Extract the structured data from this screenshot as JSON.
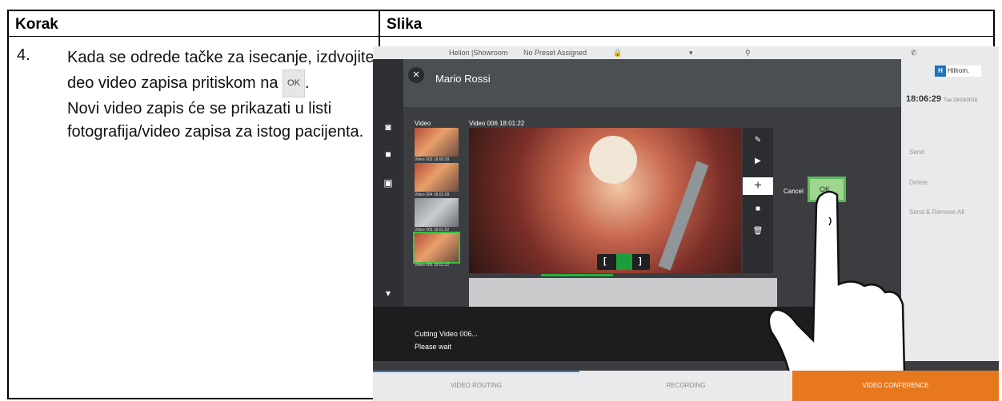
{
  "table": {
    "col1_header": "Korak",
    "col2_header": "Slika",
    "step_number": "4.",
    "step_text_line1": "Kada se odrede tačke za isecanje, izdvojite deo video zapisa pritiskom na",
    "ok_chip": "OK",
    "step_text_period": ".",
    "step_text_line2": "Novi video zapis će se prikazati u listi fotografija/video zapisa za istog pacijenta."
  },
  "screenshot": {
    "topbar_room": "Helion |Showroom",
    "topbar_preset": "No Preset Assigned",
    "patient_name": "Mario Rossi",
    "brand": "Hillrom.",
    "clock": "18:06:29",
    "clock_date": "Tue 23/10/2018",
    "right_items": [
      "Send",
      "Delete",
      "Send & Remove All"
    ],
    "video_label": "Video",
    "video_title": "Video 006 18:01:22",
    "thumb_captions": [
      "Video 003 18:00:29",
      "Video 004 18:01:09",
      "Video 005 18:01:52",
      "Video 006 18:01:22"
    ],
    "cancel_label": "Cancel",
    "ok_label": "OK",
    "cut_left": "[",
    "cut_right": "]",
    "status_line1": "Cutting Video 006...",
    "status_line2": "Please wait",
    "footer_tabs": [
      "VIDEO ROUTING",
      "RECORDING",
      "VIDEO CONFERENCE"
    ]
  },
  "colors": {
    "accent_orange": "#e8781e",
    "accent_green": "#5cb85c",
    "accent_blue": "#3a7dc9"
  }
}
